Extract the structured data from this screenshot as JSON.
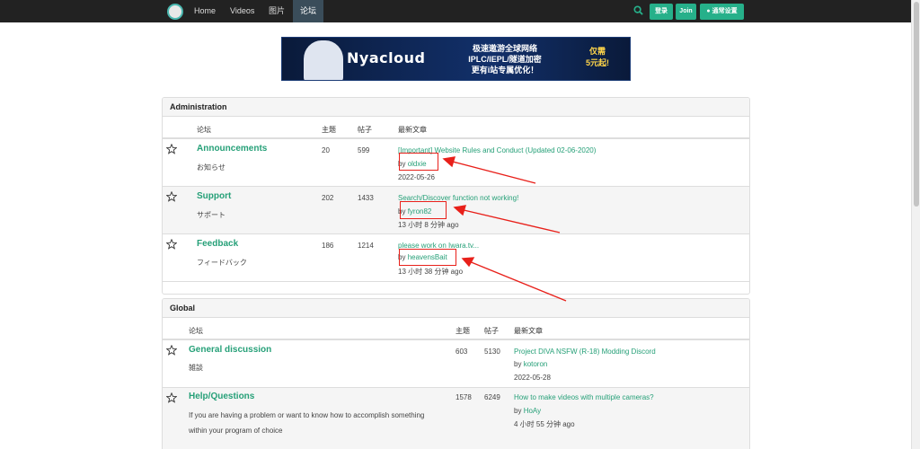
{
  "nav": {
    "links": [
      "Home",
      "Videos",
      "图片",
      "论坛"
    ],
    "active": "论坛",
    "login_label": "登录",
    "join_label": "Join",
    "settings_label": "通常设置",
    "icons": {
      "logo": "site-logo-icon",
      "search": "search-icon",
      "settings": "globe-icon"
    },
    "accent": "#26b08a"
  },
  "banner": {
    "title": "Nyacloud",
    "line1": "极速遨游全球网络",
    "line2": "IPLC/IEPL/隧道加密",
    "line3": "更有i站专属优化！",
    "price1": "仅需",
    "price2": "5元起!"
  },
  "sections": [
    {
      "title": "Administration",
      "headers": {
        "forum": "论坛",
        "topics": "主题",
        "posts": "帖子",
        "latest": "最新文章"
      },
      "rows": [
        {
          "name": "Announcements",
          "desc": "お知らせ",
          "topics": "20",
          "posts": "599",
          "latest": "[Important] Website Rules and Conduct (Updated 02-06-2020)",
          "by": "by",
          "author": "oldxie",
          "time": "2022-05-26"
        },
        {
          "name": "Support",
          "desc": "サポート",
          "topics": "202",
          "posts": "1433",
          "latest": "Search/Discover function not working!",
          "by": "by",
          "author": "fyron82",
          "time": "13 小时 8 分钟 ago"
        },
        {
          "name": "Feedback",
          "desc": "フィードバック",
          "topics": "186",
          "posts": "1214",
          "latest": "please work on Iwara.tv...",
          "by": "by",
          "author": "heavensBait",
          "time": "13 小时 38 分钟 ago"
        }
      ]
    },
    {
      "title": "Global",
      "headers": {
        "forum": "论坛",
        "topics": "主题",
        "posts": "帖子",
        "latest": "最新文章"
      },
      "rows": [
        {
          "name": "General discussion",
          "desc": "雑談",
          "topics": "603",
          "posts": "5130",
          "latest": "Project DIVA NSFW (R-18) Modding Discord",
          "by": "by",
          "author": "kotoron",
          "time": "2022-05-28"
        },
        {
          "name": "Help/Questions",
          "desc": "If you are having a problem or want to know how to accomplish something within your program of choice",
          "topics": "1578",
          "posts": "6249",
          "latest": "How to make videos with multiple cameras?",
          "by": "by",
          "author": "HoAy",
          "time": "4 小时 55 分钟 ago"
        }
      ]
    }
  ],
  "annotations": {
    "color": "#e8201a",
    "icon": "red-arrow-annotation"
  }
}
